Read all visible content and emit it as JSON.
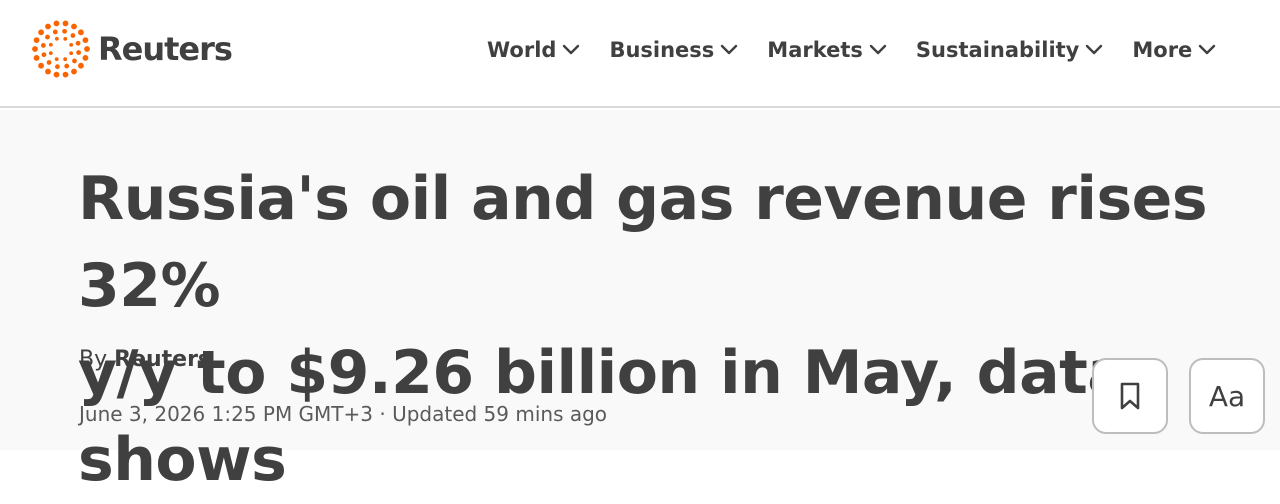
{
  "brand": {
    "name": "Reuters",
    "accent_color": "#fa6400"
  },
  "nav": {
    "items": [
      {
        "label": "World",
        "icon": "chevron-down-icon"
      },
      {
        "label": "Business",
        "icon": "chevron-down-icon"
      },
      {
        "label": "Markets",
        "icon": "chevron-down-icon"
      },
      {
        "label": "Sustainability",
        "icon": "chevron-down-icon"
      },
      {
        "label": "More",
        "icon": "chevron-down-icon"
      }
    ]
  },
  "article": {
    "headline_line1": "Russia's oil and gas revenue rises 32%",
    "headline_line2": "y/y to $9.26 billion in May, data shows",
    "by_prefix": "By",
    "author": "Reuters",
    "dateline": "June 3, 2026 1:25 PM GMT+3 · Updated 59 mins ago"
  },
  "tools": {
    "bookmark_icon": "bookmark-icon",
    "font_size_label": "Aa"
  }
}
